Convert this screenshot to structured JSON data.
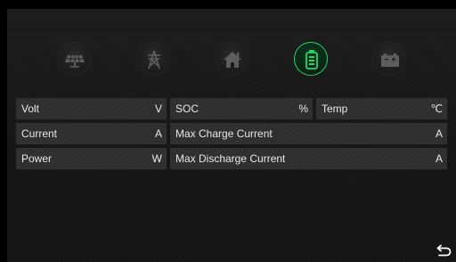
{
  "icons": [
    {
      "name": "solar-panel-icon",
      "active": false
    },
    {
      "name": "grid-tower-icon",
      "active": false
    },
    {
      "name": "home-icon",
      "active": false
    },
    {
      "name": "battery-icon",
      "active": true
    },
    {
      "name": "battery-case-icon",
      "active": false
    }
  ],
  "colors": {
    "accent": "#2bd36a",
    "icon_inactive": "#5a5a5a",
    "cell_bg": "#2d2d2d",
    "text": "#e8e8e8"
  },
  "rows": [
    [
      {
        "label": "Volt",
        "unit": "V"
      },
      {
        "label": "SOC",
        "unit": "%"
      },
      {
        "label": "Temp",
        "unit": "℃"
      }
    ],
    [
      {
        "label": "Current",
        "unit": "A"
      },
      {
        "label": "Max Charge Current",
        "unit": "A"
      }
    ],
    [
      {
        "label": "Power",
        "unit": "W"
      },
      {
        "label": "Max Discharge Current",
        "unit": "A"
      }
    ]
  ],
  "back_icon": "back-arrow-icon"
}
